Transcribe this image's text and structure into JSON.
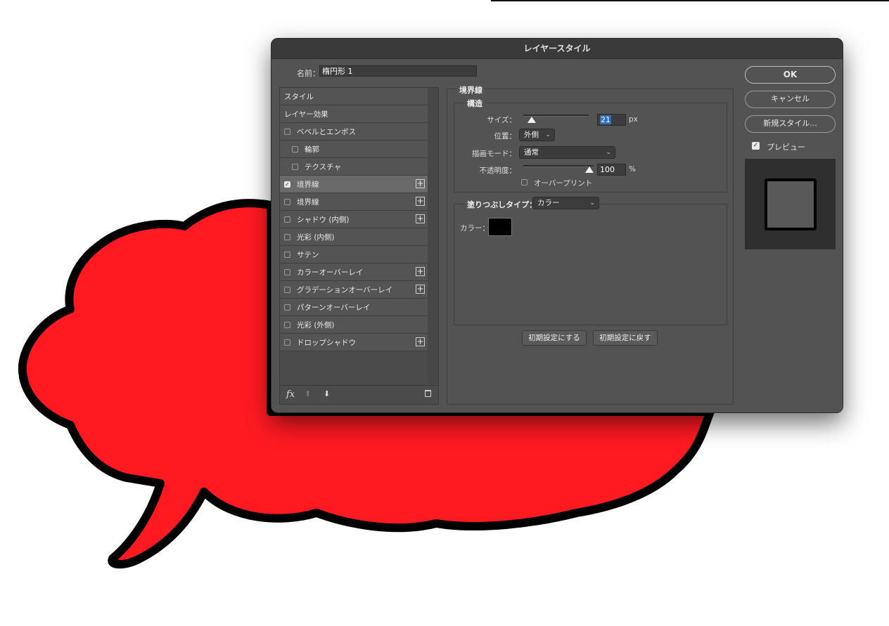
{
  "dialog": {
    "title": "レイヤースタイル"
  },
  "name_field": {
    "label": "名前：",
    "value": "楕円形 1"
  },
  "style_list": {
    "headers": [
      "スタイル",
      "レイヤー効果"
    ],
    "items": [
      {
        "label": "ベベルとエンボス",
        "checked": false,
        "plus": false,
        "selected": false,
        "indent": false
      },
      {
        "label": "輪郭",
        "checked": false,
        "plus": false,
        "selected": false,
        "indent": true
      },
      {
        "label": "テクスチャ",
        "checked": false,
        "plus": false,
        "selected": false,
        "indent": true
      },
      {
        "label": "境界線",
        "checked": true,
        "plus": true,
        "selected": true,
        "indent": false
      },
      {
        "label": "境界線",
        "checked": false,
        "plus": true,
        "selected": false,
        "indent": false
      },
      {
        "label": "シャドウ (内側)",
        "checked": false,
        "plus": true,
        "selected": false,
        "indent": false
      },
      {
        "label": "光彩 (内側)",
        "checked": false,
        "plus": false,
        "selected": false,
        "indent": false
      },
      {
        "label": "サテン",
        "checked": false,
        "plus": false,
        "selected": false,
        "indent": false
      },
      {
        "label": "カラーオーバーレイ",
        "checked": false,
        "plus": true,
        "selected": false,
        "indent": false
      },
      {
        "label": "グラデーションオーバーレイ",
        "checked": false,
        "plus": true,
        "selected": false,
        "indent": false
      },
      {
        "label": "パターンオーバーレイ",
        "checked": false,
        "plus": false,
        "selected": false,
        "indent": false
      },
      {
        "label": "光彩 (外側)",
        "checked": false,
        "plus": false,
        "selected": false,
        "indent": false
      },
      {
        "label": "ドロップシャドウ",
        "checked": false,
        "plus": true,
        "selected": false,
        "indent": false
      }
    ],
    "footer_fx": "fx"
  },
  "stroke": {
    "section_title": "境界線",
    "structure_title": "構造",
    "size_label": "サイズ：",
    "size_value": "21",
    "size_unit": "px",
    "position_label": "位置：",
    "position_value": "外側",
    "blend_label": "描画モード：",
    "blend_value": "通常",
    "opacity_label": "不透明度：",
    "opacity_value": "100",
    "opacity_unit": "%",
    "overprint_label": "オーバープリント",
    "fill_type_label": "塗りつぶしタイプ：",
    "fill_type_value": "カラー",
    "color_label": "カラー：",
    "color_value": "#000000",
    "make_default": "初期設定にする",
    "reset_default": "初期設定に戻す"
  },
  "buttons": {
    "ok": "OK",
    "cancel": "キャンセル",
    "new_style": "新規スタイル..."
  },
  "preview": {
    "label": "プレビュー",
    "checked": true
  },
  "colors": {
    "bubble_fill": "#ff1a22",
    "bubble_stroke": "#000000",
    "dialog_bg": "#535353"
  }
}
